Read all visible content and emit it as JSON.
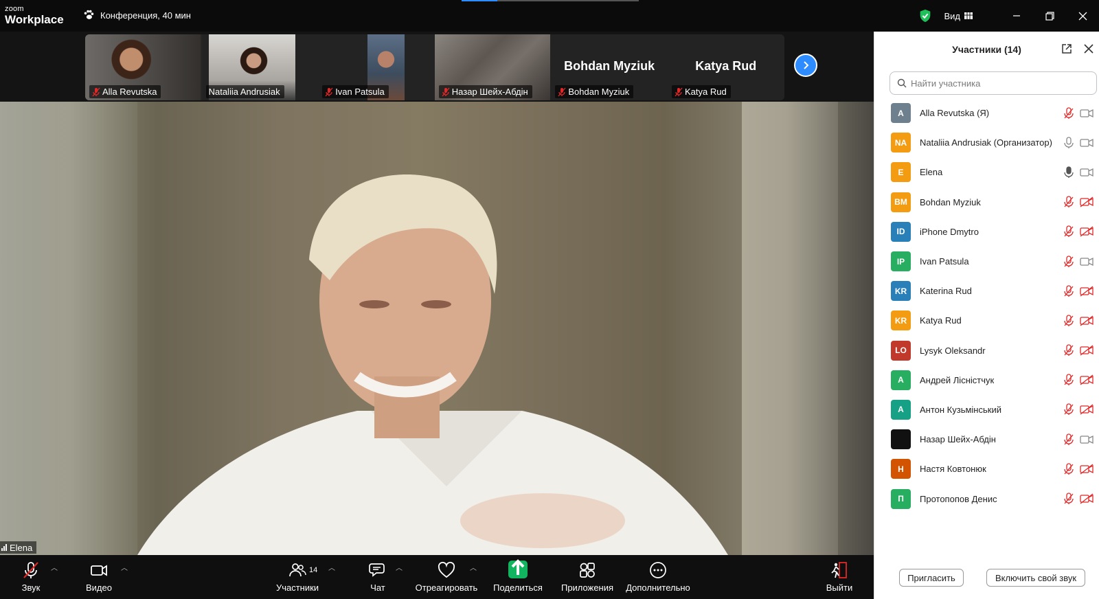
{
  "titlebar": {
    "logo_small": "zoom",
    "logo_big": "Workplace",
    "meeting_info": "Конференция, 40 мин",
    "view_label": "Вид"
  },
  "thumbnails": [
    {
      "name": "Alla Revutska",
      "muted": true,
      "video": true
    },
    {
      "name": "Nataliia Andrusiak",
      "muted": false,
      "video": true
    },
    {
      "name": "Ivan Patsula",
      "muted": true,
      "video": true
    },
    {
      "name": "Назар Шейх-Абдін",
      "muted": true,
      "video": true
    },
    {
      "name": "Bohdan Myziuk",
      "muted": true,
      "video": false,
      "big_name": "Bohdan Myziuk"
    },
    {
      "name": "Katya Rud",
      "muted": true,
      "video": false,
      "big_name": "Katya Rud"
    }
  ],
  "stage": {
    "speaker_name": "Elena"
  },
  "toolbar": {
    "audio_label": "Звук",
    "video_label": "Видео",
    "participants_label": "Участники",
    "participants_count": "14",
    "chat_label": "Чат",
    "react_label": "Отреагировать",
    "share_label": "Поделиться",
    "apps_label": "Приложения",
    "more_label": "Дополнительно",
    "leave_label": "Выйти"
  },
  "panel": {
    "title": "Участники (14)",
    "search_placeholder": "Найти участника",
    "invite_label": "Пригласить",
    "unmute_label": "Включить свой звук",
    "participants": [
      {
        "initials": "A",
        "name": "Alla Revutska (Я)",
        "color": "#6e7f8d",
        "mic": "muted",
        "cam": "on"
      },
      {
        "initials": "NA",
        "name": "Nataliia Andrusiak (Организатор)",
        "color": "#f39c12",
        "mic": "on",
        "cam": "on"
      },
      {
        "initials": "E",
        "name": "Elena",
        "color": "#f39c12",
        "mic": "active",
        "cam": "on"
      },
      {
        "initials": "BM",
        "name": "Bohdan Myziuk",
        "color": "#f39c12",
        "mic": "muted",
        "cam": "off"
      },
      {
        "initials": "ID",
        "name": "iPhone Dmytro",
        "color": "#2980b9",
        "mic": "muted",
        "cam": "off"
      },
      {
        "initials": "IP",
        "name": "Ivan Patsula",
        "color": "#27ae60",
        "mic": "muted",
        "cam": "on"
      },
      {
        "initials": "KR",
        "name": "Katerina Rud",
        "color": "#2980b9",
        "mic": "muted",
        "cam": "off"
      },
      {
        "initials": "KR",
        "name": "Katya Rud",
        "color": "#f39c12",
        "mic": "muted",
        "cam": "off"
      },
      {
        "initials": "LO",
        "name": "Lysyk Oleksandr",
        "color": "#c0392b",
        "mic": "muted",
        "cam": "off"
      },
      {
        "initials": "A",
        "name": "Андрей Лісністчук",
        "color": "#27ae60",
        "mic": "muted",
        "cam": "off"
      },
      {
        "initials": "A",
        "name": "Антон Кузьмінський",
        "color": "#16a085",
        "mic": "muted",
        "cam": "off"
      },
      {
        "initials": "",
        "name": "Назар Шейх-Абдін",
        "color": "#111111",
        "mic": "muted",
        "cam": "on"
      },
      {
        "initials": "Н",
        "name": "Настя Ковтонюк",
        "color": "#d35400",
        "mic": "muted",
        "cam": "off"
      },
      {
        "initials": "П",
        "name": "Протопопов Денис",
        "color": "#27ae60",
        "mic": "muted",
        "cam": "off"
      }
    ]
  }
}
